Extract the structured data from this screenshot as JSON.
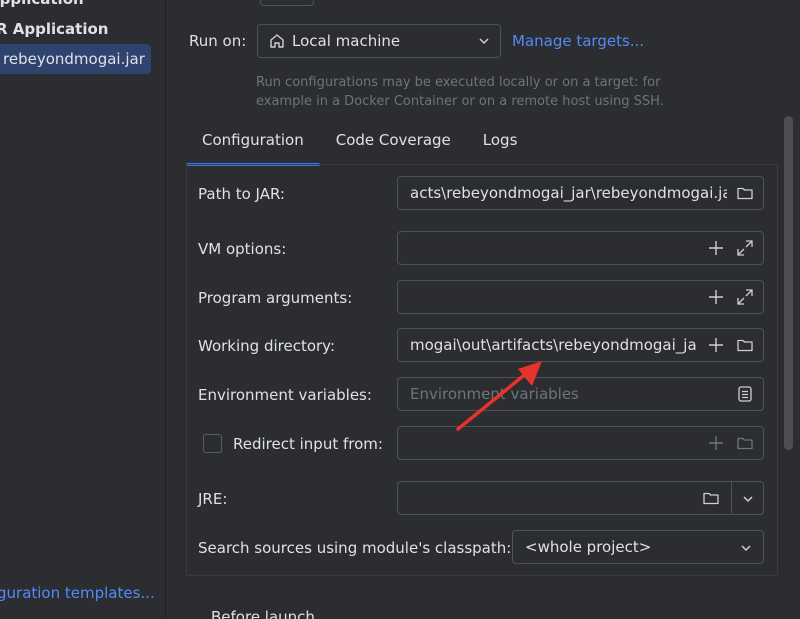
{
  "sidebar": {
    "cut_top_label": "Application",
    "group_label": "R Application",
    "selected_item": "rebeyondmogai.jar",
    "templates_link": "guration templates..."
  },
  "run_on": {
    "label": "Run on:",
    "value": "Local machine",
    "manage_link": "Manage targets...",
    "help_text": "Run configurations may be executed locally or on a target: for example in a Docker Container or on a remote host using SSH."
  },
  "tabs": [
    {
      "label": "Configuration",
      "active": true
    },
    {
      "label": "Code Coverage",
      "active": false
    },
    {
      "label": "Logs",
      "active": false
    }
  ],
  "config": {
    "path_to_jar": {
      "label": "Path to JAR:",
      "value": "acts\\rebeyondmogai_jar\\rebeyondmogai.jar"
    },
    "vm_options": {
      "label": "VM options:",
      "value": ""
    },
    "program_arguments": {
      "label": "Program arguments:",
      "value": ""
    },
    "working_directory": {
      "label": "Working directory:",
      "value": "mogai\\out\\artifacts\\rebeyondmogai_jar"
    },
    "environment_variables": {
      "label": "Environment variables:",
      "placeholder": "Environment variables"
    },
    "redirect_input": {
      "label": "Redirect input from:",
      "checked": false,
      "value": ""
    },
    "jre": {
      "label": "JRE:",
      "value": ""
    },
    "classpath": {
      "label": "Search sources using module's classpath:",
      "value": "<whole project>"
    }
  },
  "bottom_cut_label": "Before launch",
  "colors": {
    "background": "#2b2d30",
    "link": "#548af7",
    "accent": "#3574f0",
    "selection": "#2e436e",
    "annotation": "#e8322c"
  }
}
